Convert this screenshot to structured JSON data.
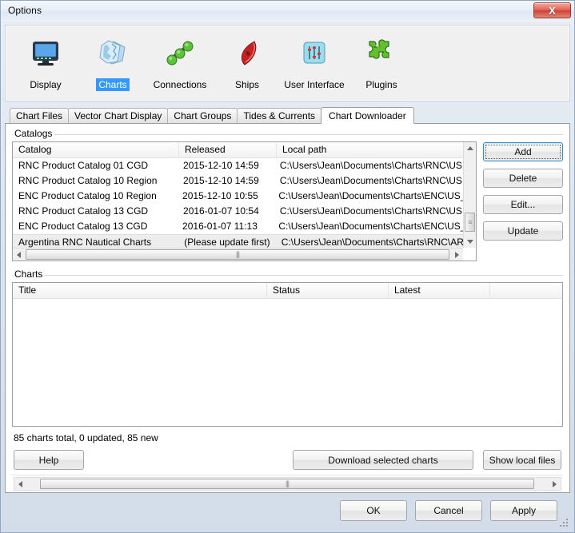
{
  "window": {
    "title": "Options",
    "close_label": "X"
  },
  "toolbar": {
    "items": [
      {
        "label": "Display",
        "icon": "monitor-icon",
        "selected": false
      },
      {
        "label": "Charts",
        "icon": "charts-icon",
        "selected": true
      },
      {
        "label": "Connections",
        "icon": "connections-icon",
        "selected": false
      },
      {
        "label": "Ships",
        "icon": "ship-icon",
        "selected": false
      },
      {
        "label": "User Interface",
        "icon": "sliders-icon",
        "selected": false
      },
      {
        "label": "Plugins",
        "icon": "puzzle-icon",
        "selected": false
      }
    ]
  },
  "tabs": [
    {
      "label": "Chart Files",
      "active": false
    },
    {
      "label": "Vector Chart Display",
      "active": false
    },
    {
      "label": "Chart Groups",
      "active": false
    },
    {
      "label": "Tides & Currents",
      "active": false
    },
    {
      "label": "Chart Downloader",
      "active": true
    }
  ],
  "catalogs": {
    "group_label": "Catalogs",
    "columns": [
      "Catalog",
      "Released",
      "Local path"
    ],
    "rows": [
      {
        "catalog": "RNC Product Catalog 01 CGD",
        "released": "2015-12-10 14:59",
        "local_path": "C:\\Users\\Jean\\Documents\\Charts\\RNC\\US.",
        "selected": false
      },
      {
        "catalog": "RNC Product Catalog 10 Region",
        "released": "2015-12-10 14:59",
        "local_path": "C:\\Users\\Jean\\Documents\\Charts\\RNC\\US.",
        "selected": false
      },
      {
        "catalog": "ENC Product Catalog 10 Region",
        "released": "2015-12-10 10:55",
        "local_path": "C:\\Users\\Jean\\Documents\\Charts\\ENC\\US_",
        "selected": false
      },
      {
        "catalog": "RNC Product Catalog 13 CGD",
        "released": "2016-01-07 10:54",
        "local_path": "C:\\Users\\Jean\\Documents\\Charts\\RNC\\US.",
        "selected": false
      },
      {
        "catalog": "ENC Product Catalog 13 CGD",
        "released": "2016-01-07 11:13",
        "local_path": "C:\\Users\\Jean\\Documents\\Charts\\ENC\\US_",
        "selected": false
      },
      {
        "catalog": "Argentina RNC Nautical Charts",
        "released": "(Please update first)",
        "local_path": "C:\\Users\\Jean\\Documents\\Charts\\RNC\\AR",
        "selected": true
      }
    ],
    "buttons": {
      "add": "Add",
      "delete": "Delete",
      "edit": "Edit...",
      "update": "Update"
    }
  },
  "charts": {
    "group_label": "Charts",
    "columns": [
      "Title",
      "Status",
      "Latest",
      ""
    ],
    "rows": []
  },
  "status": {
    "text": "85 charts total, 0 updated, 85 new",
    "charts_total": 85,
    "updated": 0,
    "new": 85
  },
  "actions": {
    "help": "Help",
    "download_selected": "Download selected charts",
    "show_local_files": "Show local files"
  },
  "footer": {
    "ok": "OK",
    "cancel": "Cancel",
    "apply": "Apply"
  },
  "colors": {
    "selection_blue": "#3399ff",
    "focus_border": "#3c8dc5",
    "close_red": "#cf4436",
    "window_bg": "#f0f0f0"
  }
}
